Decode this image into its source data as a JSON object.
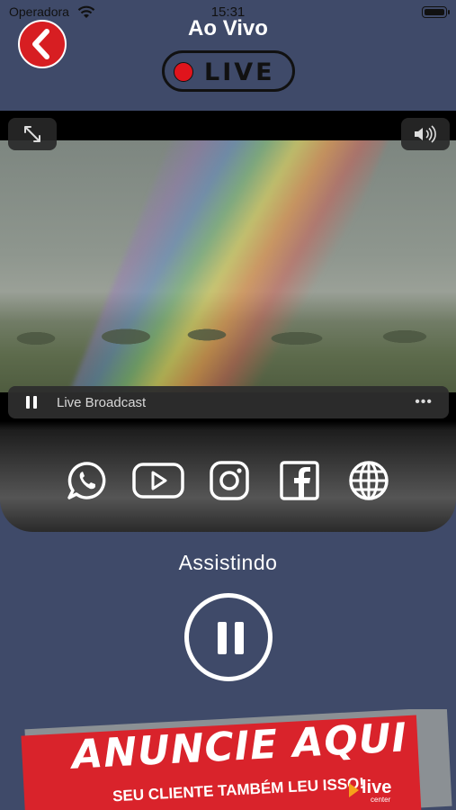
{
  "status_bar": {
    "carrier": "Operadora",
    "time": "15:31"
  },
  "header": {
    "title": "Ao Vivo",
    "live_badge": "LIVE"
  },
  "player": {
    "broadcast_label": "Live Broadcast",
    "more_label": "•••"
  },
  "social": [
    {
      "icon": "whatsapp-icon"
    },
    {
      "icon": "youtube-icon"
    },
    {
      "icon": "instagram-icon"
    },
    {
      "icon": "facebook-icon"
    },
    {
      "icon": "globe-icon"
    }
  ],
  "playback": {
    "status": "Assistindo"
  },
  "ad": {
    "title": "ANUNCIE AQUI",
    "subtitle": "SEU CLIENTE TAMBÉM LEU ISSO!",
    "logo_text": "live",
    "logo_sub": "center"
  },
  "colors": {
    "background": "#3f4a69",
    "back_button": "#d71e22",
    "live_dot": "#e0141c",
    "ad_red": "#d9232b",
    "ad_logo": "#f7a11a"
  }
}
